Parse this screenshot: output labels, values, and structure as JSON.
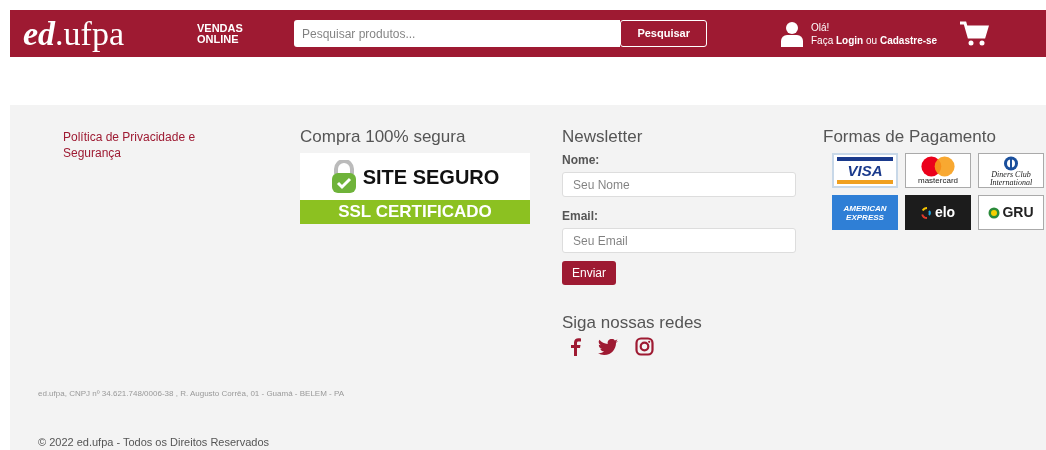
{
  "header": {
    "logo_bold": "ed",
    "logo_rest": ".ufpa",
    "tagline": [
      "VENDAS",
      "ONLINE"
    ],
    "search": {
      "placeholder": "Pesquisar produtos...",
      "button": "Pesquisar"
    },
    "greeting": "Olá!",
    "account": "Faça **Login** ou **Cadastre-se**"
  },
  "footer": {
    "privacy_link": "Política de Privacidade e Segurança",
    "security": {
      "title": "Compra 100% segura",
      "badge_top": "SITE SEGURO",
      "badge_bottom": "SSL CERTIFICADO"
    },
    "newsletter": {
      "title": "Newsletter",
      "fields": [
        {
          "label": "Nome:",
          "placeholder": "Seu Nome"
        },
        {
          "label": "Email:",
          "placeholder": "Seu Email"
        }
      ],
      "button": "Enviar"
    },
    "social": {
      "title": "Siga nossas redes",
      "networks": [
        {
          "kind": "facebook"
        },
        {
          "kind": "twitter"
        },
        {
          "kind": "instagram"
        }
      ]
    },
    "payment": {
      "title": "Formas de Pagamento",
      "methods": [
        {
          "kind": "visa",
          "label": "VISA"
        },
        {
          "kind": "mastercard",
          "label": "mastercard"
        },
        {
          "kind": "diners",
          "label": "Diners Club International"
        },
        {
          "kind": "amex",
          "label": "AMERICAN EXPRESS"
        },
        {
          "kind": "elo",
          "label": "elo"
        },
        {
          "kind": "gru",
          "label": "GRU"
        }
      ]
    },
    "address": "ed.ufpa, CNPJ nº 34.621.748/0006-38 , R. Augusto Corrêa, 01 - Guamá - BELEM - PA",
    "copyright": "© 2022 ed.ufpa - Todos os Direitos Reservados"
  }
}
